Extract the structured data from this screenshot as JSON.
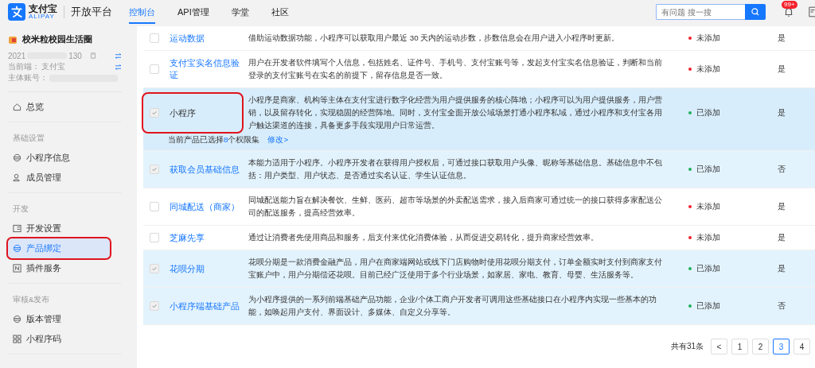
{
  "header": {
    "logo_name": "支付宝",
    "logo_sub": "ALIPAY",
    "platform": "开放平台",
    "tabs": [
      {
        "label": "控制台",
        "selected": true
      },
      {
        "label": "API管理",
        "selected": false
      },
      {
        "label": "学堂",
        "selected": false
      },
      {
        "label": "社区",
        "selected": false
      }
    ],
    "search": {
      "placeholder": "有问题 搜一搜"
    },
    "notifications": {
      "badge": "99+"
    }
  },
  "sidebar": {
    "app_name": "校米粒校园生活圈",
    "id_start": "2021",
    "id_end": "130",
    "client_label": "当前端：",
    "client_value": "支付宝",
    "account_label": "主体账号：",
    "groups": [
      {
        "items": [
          {
            "label": "总览",
            "selected": false,
            "highlighted": false
          }
        ]
      },
      {
        "title": "基础设置",
        "items": [
          {
            "label": "小程序信息",
            "selected": false,
            "highlighted": false
          },
          {
            "label": "成员管理",
            "selected": false,
            "highlighted": false
          }
        ]
      },
      {
        "title": "开发",
        "items": [
          {
            "label": "开发设置",
            "selected": false,
            "highlighted": false
          },
          {
            "label": "产品绑定",
            "selected": true,
            "highlighted": true
          },
          {
            "label": "插件服务",
            "selected": false,
            "highlighted": false
          }
        ]
      },
      {
        "title": "审核&发布",
        "items": [
          {
            "label": "版本管理",
            "selected": false,
            "highlighted": false
          },
          {
            "label": "小程序码",
            "selected": false,
            "highlighted": false
          }
        ]
      }
    ]
  },
  "table": {
    "rows": [
      {
        "name": "运动数据",
        "description": "借助运动数据功能，小程序可以获取用户最近 30 天内的运动步数，步数信息会在用户进入小程序时更新。",
        "status": "未添加",
        "added": false,
        "column_4": "是",
        "checked": false,
        "highlighted": false
      },
      {
        "name": "支付宝实名信息验证",
        "description": "用户在开发者软件填写个人信息，包括姓名、证件号、手机号、支付宝账号等，发起支付宝实名信息验证，判断和当前登录的支付宝账号在实名的前提下，留存信息是否一致。",
        "status": "未添加",
        "added": false,
        "column_4": "是",
        "checked": false,
        "highlighted": false
      },
      {
        "name": "小程序",
        "description": "小程序是商家、机构等主体在支付宝进行数字化经营为用户提供服务的核心阵地；小程序可以为用户提供服务，用户营销，以及留存转化，实现稳固的经营阵地。同时，支付宝全面开放公域场景打通小程序私域，通过小程序和支付宝各用户触达渠道的连接，具备更多手段实现用户日常运营。",
        "status": "已添加",
        "added": true,
        "column_4": "是",
        "checked": true,
        "highlighted": true,
        "note": "当前产品已选择**8**个权限集",
        "note_link": "修改>"
      },
      {
        "name": "获取会员基础信息",
        "description": "本能力适用于小程序。小程序开发者在获得用户授权后，可通过接口获取用户头像、昵称等基础信息。基础信息中不包括：用户类型、用户状态、是否通过实名认证、学生认证信息。",
        "status": "已添加",
        "added": true,
        "column_4": "否",
        "checked": true,
        "highlighted": false
      },
      {
        "name": "同城配送（商家）",
        "description": "同城配送能力旨在解决餐饮、生鲜、医药、超市等场景的外卖配送需求，接入后商家可通过统一的接口获得多家配送公司的配送服务，提高经营效率。",
        "status": "未添加",
        "added": false,
        "column_4": "是",
        "checked": false,
        "highlighted": false
      },
      {
        "name": "芝麻先享",
        "description": "通过让消费者先使用商品和服务，后支付来优化消费体验，从而促进交易转化，提升商家经营效率。",
        "status": "未添加",
        "added": false,
        "column_4": "是",
        "checked": false,
        "highlighted": false
      },
      {
        "name": "花呗分期",
        "description": "花呗分期是一款消费金融产品，用户在商家端网站或线下门店购物时使用花呗分期支付，订单全额实时支付到商家支付宝账户中，用户分期偿还花呗。目前已经广泛使用于多个行业场景，如家居、家电、教育、母婴、生活服务等。",
        "status": "已添加",
        "added": true,
        "column_4": "是",
        "checked": true,
        "highlighted": false
      },
      {
        "name": "小程序端基础产品",
        "description": "为小程序提供的一系列前端基础产品功能，企业/个体工商户开发者可调用这些基础接口在小程序内实现一些基本的功能，如唤起用户支付、界面设计、多媒体、自定义分享等。",
        "status": "已添加",
        "added": true,
        "column_4": "否",
        "checked": true,
        "highlighted": false
      }
    ]
  },
  "pagination": {
    "total": "共有31条",
    "prev": "<",
    "pages": [
      {
        "label": "1",
        "selected": false
      },
      {
        "label": "2",
        "selected": false
      },
      {
        "label": "3",
        "selected": true
      },
      {
        "label": "4",
        "selected": false
      }
    ]
  }
}
